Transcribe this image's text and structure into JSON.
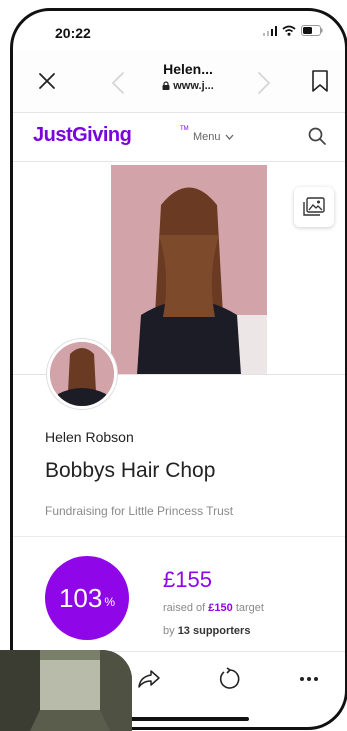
{
  "status": {
    "time": "20:22"
  },
  "browser": {
    "title": "Helen...",
    "url": "www.j..."
  },
  "site": {
    "logo": "JustGiving",
    "menu_label": "Menu"
  },
  "page": {
    "owner": "Helen Robson",
    "title": "Bobbys Hair Chop",
    "cause": "Fundraising for Little Princess Trust"
  },
  "stats": {
    "percent": "103",
    "percent_sign": "%",
    "percent_value": 103,
    "raised": "£155",
    "raised_text": "raised of",
    "target": "£150",
    "target_text": "target",
    "by_text": "by",
    "supporters": "13 supporters"
  },
  "colors": {
    "brand": "#7a04dd",
    "accent": "#8f06e8"
  },
  "icons": {
    "close": "close-icon",
    "back": "chevron-left-icon",
    "forward": "chevron-right-icon",
    "bookmark": "bookmark-icon",
    "search": "search-icon",
    "gallery": "image-gallery-icon",
    "info": "info-icon",
    "share": "share-icon",
    "reload": "reload-icon",
    "more": "more-icon"
  }
}
